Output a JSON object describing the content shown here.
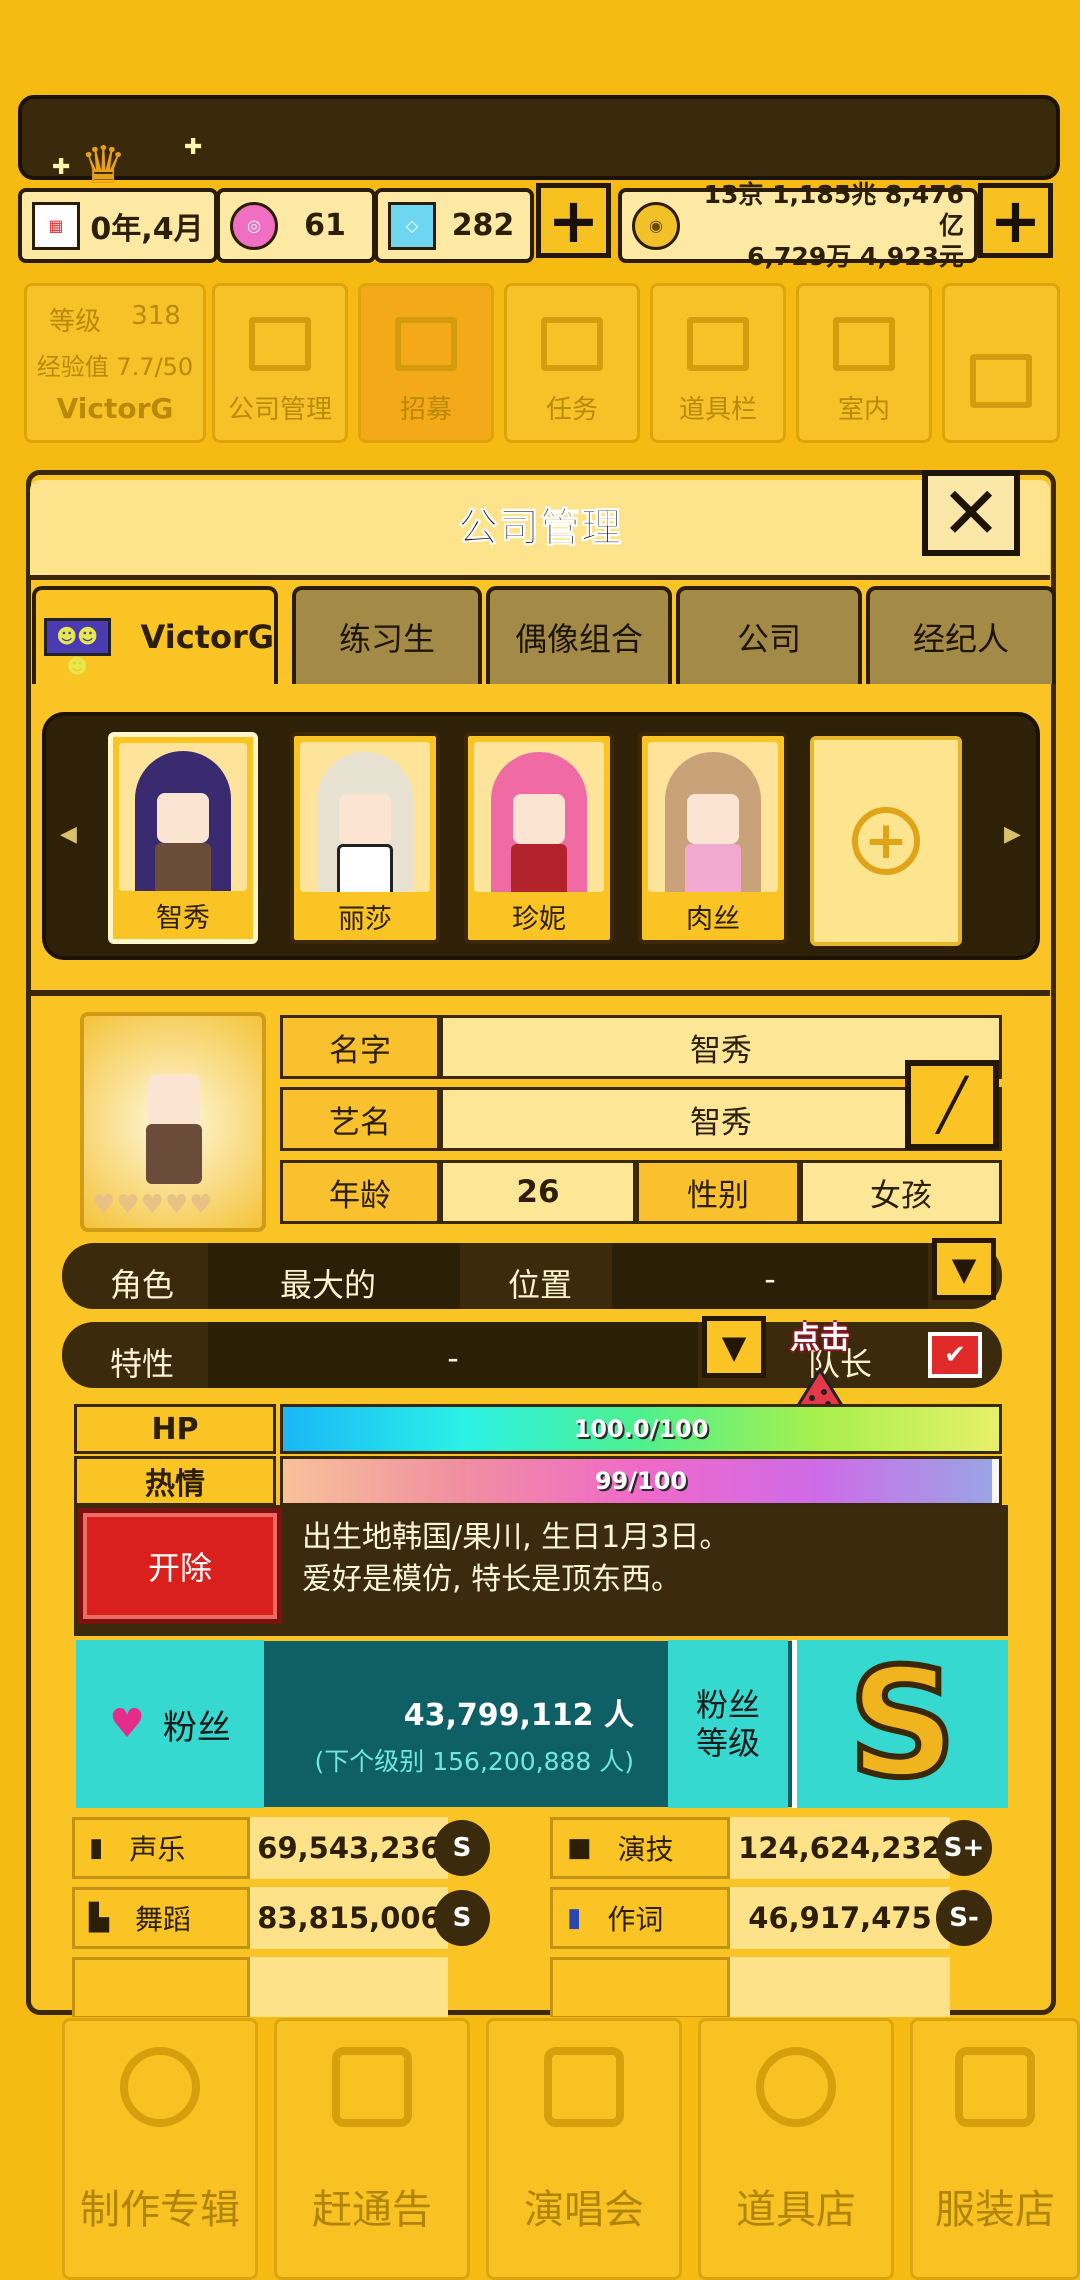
{
  "header": {
    "date": "0年,4月",
    "gems_pink": "61",
    "gems_blue": "282",
    "money_line1": "13京 1,185兆 8,476亿",
    "money_line2": "6,729万 4,923元"
  },
  "profile_tile": {
    "level_label": "等级",
    "level_value": "318",
    "exp_label": "经验值 7.7/50",
    "name": "VictorG"
  },
  "top_menu": [
    "公司管理",
    "招募",
    "任务",
    "道具栏",
    "室内"
  ],
  "panel": {
    "title": "公司管理"
  },
  "tabs": [
    "VictorG",
    "练习生",
    "偶像组合",
    "公司",
    "经纪人"
  ],
  "members": [
    "智秀",
    "丽莎",
    "珍妮",
    "肉丝"
  ],
  "member_info": {
    "name_label": "名字",
    "name_value": "智秀",
    "stage_label": "艺名",
    "stage_value": "智秀",
    "age_label": "年龄",
    "age_value": "26",
    "gender_label": "性别",
    "gender_value": "女孩",
    "role_label": "角色",
    "role_value": "最大的",
    "position_label": "位置",
    "position_value": "-",
    "trait_label": "特性",
    "trait_value": "-",
    "leader_label": "队长",
    "tap_hint": "点击"
  },
  "stats": {
    "hp_label": "HP",
    "hp_text": "100.0/100",
    "hp_fraction": 1.0,
    "passion_label": "热情",
    "passion_text": "99/100",
    "passion_fraction": 0.99
  },
  "fire_button": "开除",
  "bio": {
    "line1": "出生地韩国/果川, 生日1月3日。",
    "line2": "爱好是模仿, 特长是顶东西。"
  },
  "fans": {
    "label": "粉丝",
    "count": "43,799,112 人",
    "next": "(下个级别 156,200,888 人)",
    "level_label_1": "粉丝",
    "level_label_2": "等级",
    "rank": "S"
  },
  "skills": [
    {
      "label": "声乐",
      "value": "69,543,236",
      "grade": "S"
    },
    {
      "label": "演技",
      "value": "124,624,232",
      "grade": "S+"
    },
    {
      "label": "舞蹈",
      "value": "83,815,006",
      "grade": "S"
    },
    {
      "label": "作词",
      "value": "46,917,475",
      "grade": "S-"
    }
  ],
  "bottom_nav": [
    "制作专辑",
    "赶通告",
    "演唱会",
    "道具店",
    "服装店"
  ],
  "colors": {
    "background": "#f6bb12",
    "dark": "#3b2a0b",
    "teal": "#35d9cf",
    "fire_red": "#d9201d"
  }
}
